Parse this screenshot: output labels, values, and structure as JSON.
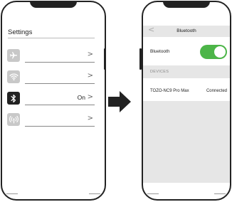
{
  "settings": {
    "title": "Settings",
    "items": [
      {
        "icon": "airplane-icon",
        "value": "",
        "chevron": ">"
      },
      {
        "icon": "wifi-icon",
        "value": "",
        "chevron": ">"
      },
      {
        "icon": "bluetooth-icon",
        "value": "On",
        "chevron": ">"
      },
      {
        "icon": "cellular-icon",
        "value": "",
        "chevron": ">"
      }
    ]
  },
  "bluetooth": {
    "back": "<",
    "title": "Bluetooth",
    "toggle_label": "Bluetooth",
    "toggle_on": true,
    "section_header": "DEVICES",
    "devices": [
      {
        "name": "TOZO-NC9 Pro Max",
        "status": "Connected"
      }
    ]
  },
  "colors": {
    "toggle_on": "#4cb548",
    "icon_inactive": "#c8c8c8",
    "icon_active": "#222222",
    "section_bg": "#e6e6e6"
  }
}
